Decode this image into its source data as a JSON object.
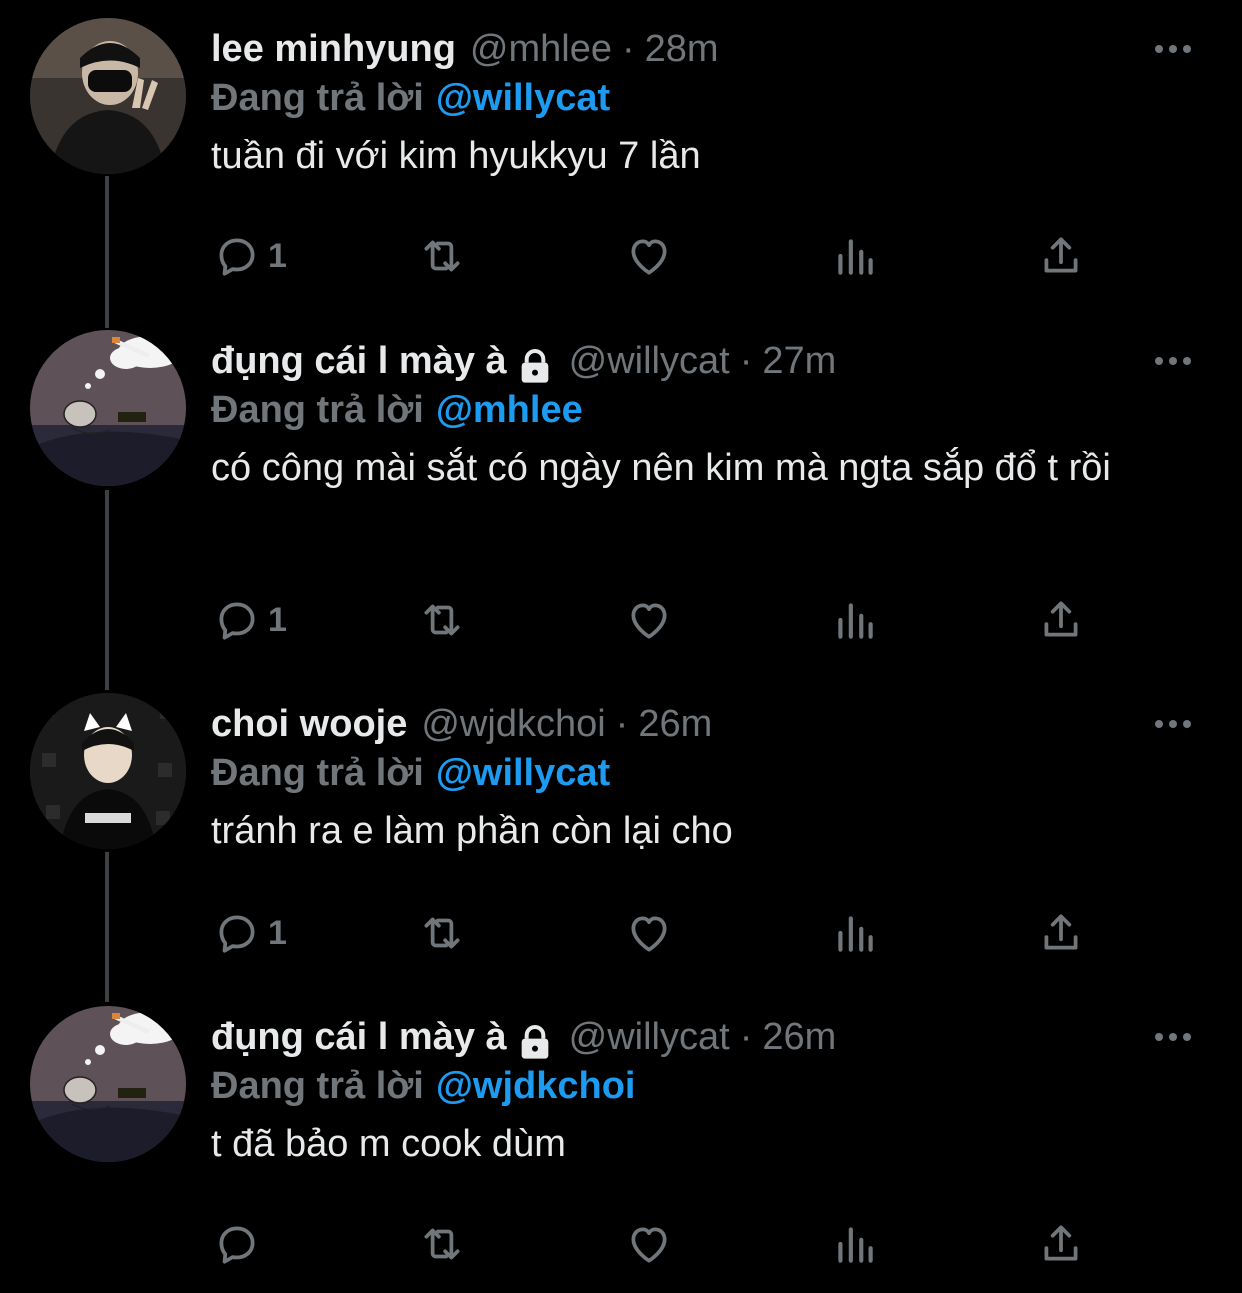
{
  "tweets": [
    {
      "name": "lee minhyung",
      "locked": false,
      "handle": "@mhlee",
      "sep": "·",
      "time": "28m",
      "reply_prefix": "Đang trả lời",
      "reply_to": "@willycat",
      "text": "tuần đi với kim hyukkyu 7 lần",
      "reply_count": "1",
      "avatar": "avatar-photo-masked-person"
    },
    {
      "name": "đụng cái l mày à",
      "locked": true,
      "handle": "@willycat",
      "sep": "·",
      "time": "27m",
      "reply_prefix": "Đang trả lời",
      "reply_to": "@mhlee",
      "text": "có công mài sắt có ngày nên kim mà ngta sắp đổ t rồi",
      "reply_count": "1",
      "avatar": "avatar-drawing-sleeping-character"
    },
    {
      "name": "choi wooje",
      "locked": false,
      "handle": "@wjdkchoi",
      "sep": "·",
      "time": "26m",
      "reply_prefix": "Đang trả lời",
      "reply_to": "@willycat",
      "text": "tránh ra e làm phần còn lại cho",
      "reply_count": "1",
      "avatar": "avatar-photo-cat-ears-person"
    },
    {
      "name": "đụng cái l mày à",
      "locked": true,
      "handle": "@willycat",
      "sep": "·",
      "time": "26m",
      "reply_prefix": "Đang trả lời",
      "reply_to": "@wjdkchoi",
      "text": "t đã bảo m cook dùm",
      "reply_count": "",
      "avatar": "avatar-drawing-sleeping-character"
    }
  ],
  "icons": {
    "reply": "reply-icon",
    "retweet": "retweet-icon",
    "like": "heart-icon",
    "views": "views-icon",
    "share": "share-icon",
    "more": "more-dots-icon",
    "lock": "lock-icon"
  },
  "colors": {
    "background": "#000000",
    "text": "#e7e9ea",
    "muted": "#71767b",
    "link": "#1d9bf0",
    "thread_line": "#3e4144"
  }
}
